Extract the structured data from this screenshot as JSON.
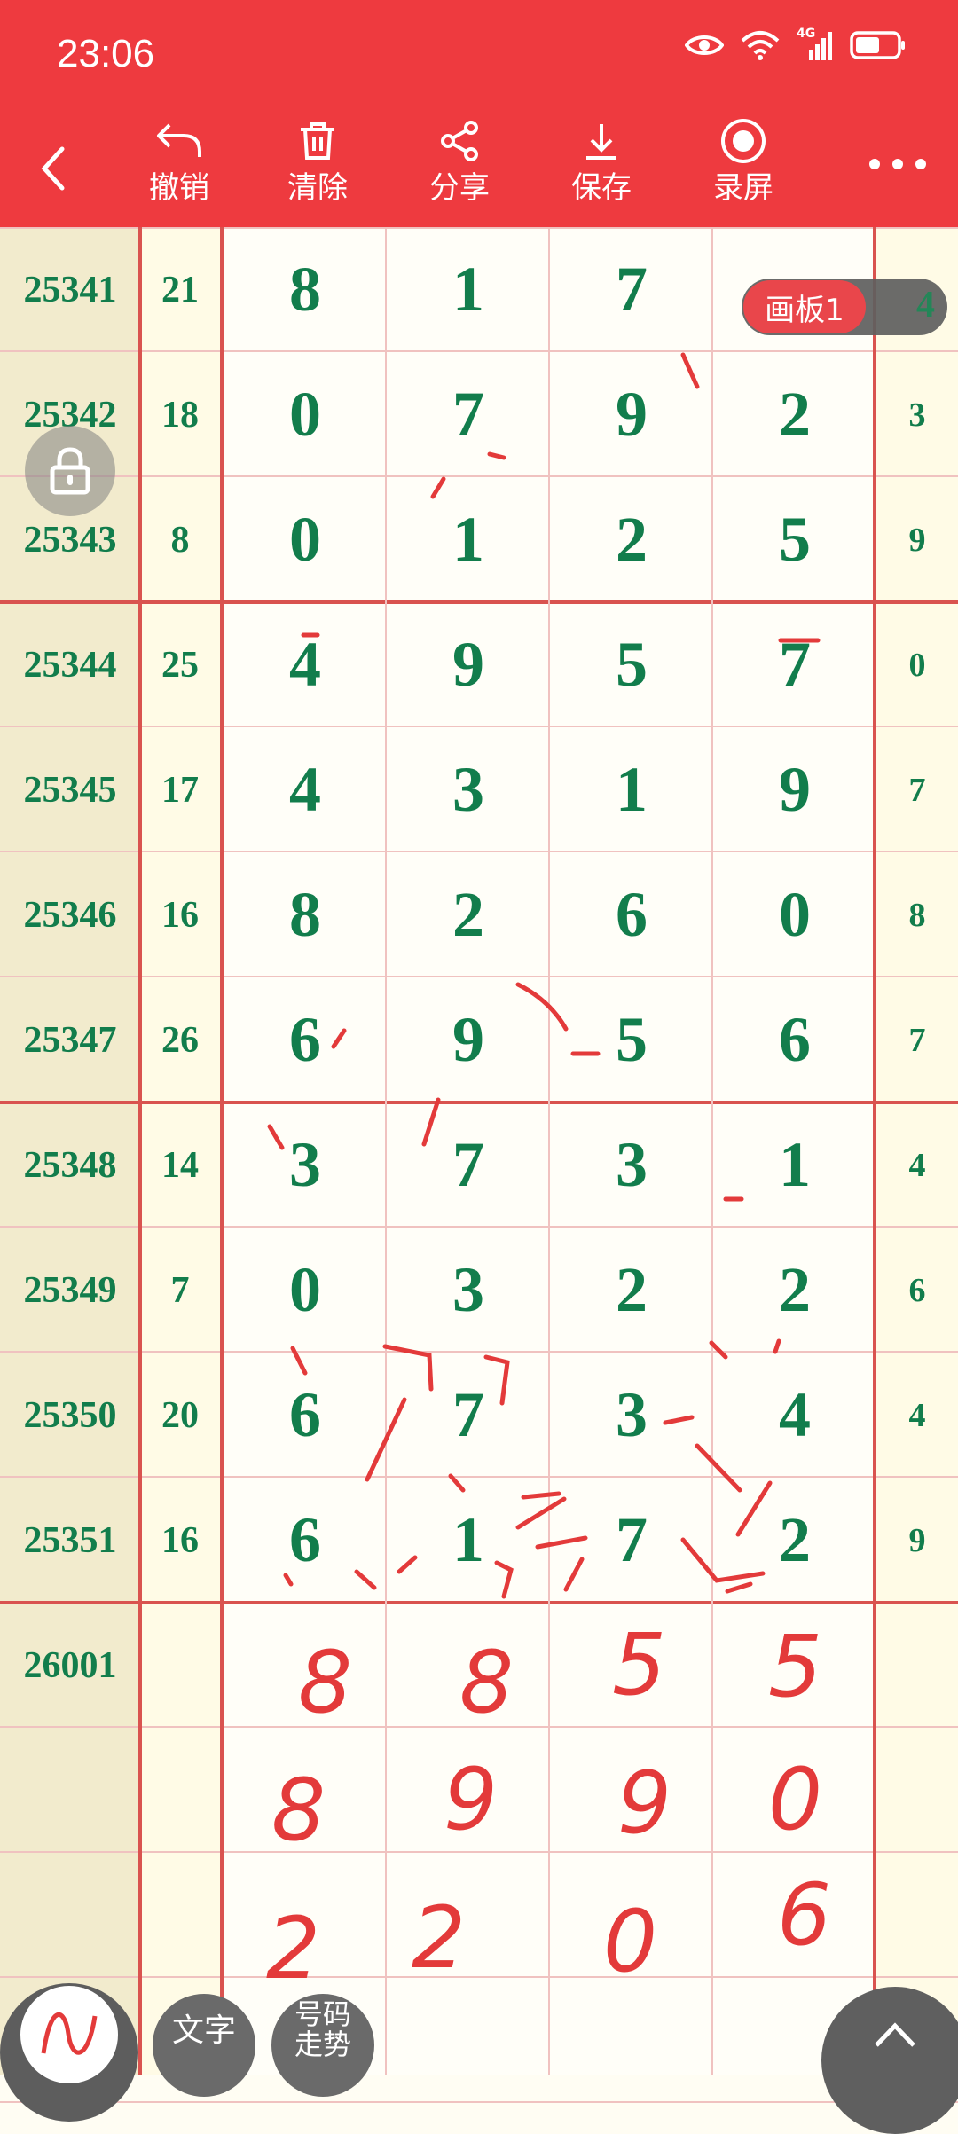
{
  "status": {
    "time": "23:06",
    "network": "4G"
  },
  "toolbar": {
    "back_icon": "back-chevron-icon",
    "items": [
      {
        "label": "撤销",
        "icon": "undo-icon"
      },
      {
        "label": "清除",
        "icon": "trash-icon"
      },
      {
        "label": "分享",
        "icon": "share-icon"
      },
      {
        "label": "保存",
        "icon": "download-icon"
      },
      {
        "label": "录屏",
        "icon": "record-icon"
      }
    ],
    "more_icon": "more-dots-icon"
  },
  "colors": {
    "header": "#ee3a3f",
    "digit": "#127d4c",
    "ink": "#e33a3a"
  },
  "board": {
    "label": "画板1",
    "last_peek": "4"
  },
  "rows": [
    {
      "period": "25341",
      "sum": "21",
      "d": [
        "8",
        "1",
        "7",
        ""
      ],
      "last": ""
    },
    {
      "period": "25342",
      "sum": "18",
      "d": [
        "0",
        "7",
        "9",
        "2"
      ],
      "last": "3"
    },
    {
      "period": "25343",
      "sum": "8",
      "d": [
        "0",
        "1",
        "2",
        "5"
      ],
      "last": "9"
    },
    {
      "period": "25344",
      "sum": "25",
      "d": [
        "4",
        "9",
        "5",
        "7"
      ],
      "last": "0"
    },
    {
      "period": "25345",
      "sum": "17",
      "d": [
        "4",
        "3",
        "1",
        "9"
      ],
      "last": "7"
    },
    {
      "period": "25346",
      "sum": "16",
      "d": [
        "8",
        "2",
        "6",
        "0"
      ],
      "last": "8"
    },
    {
      "period": "25347",
      "sum": "26",
      "d": [
        "6",
        "9",
        "5",
        "6"
      ],
      "last": "7"
    },
    {
      "period": "25348",
      "sum": "14",
      "d": [
        "3",
        "7",
        "3",
        "1"
      ],
      "last": "4"
    },
    {
      "period": "25349",
      "sum": "7",
      "d": [
        "0",
        "3",
        "2",
        "2"
      ],
      "last": "6"
    },
    {
      "period": "25350",
      "sum": "20",
      "d": [
        "6",
        "7",
        "3",
        "4"
      ],
      "last": "4"
    },
    {
      "period": "25351",
      "sum": "16",
      "d": [
        "6",
        "1",
        "7",
        "2"
      ],
      "last": "9"
    },
    {
      "period": "26001",
      "sum": "",
      "d": [
        "",
        "",
        "",
        ""
      ],
      "last": ""
    },
    {
      "period": "",
      "sum": "",
      "d": [
        "",
        "",
        "",
        ""
      ],
      "last": ""
    },
    {
      "period": "",
      "sum": "",
      "d": [
        "",
        "",
        "",
        ""
      ],
      "last": ""
    },
    {
      "period": "",
      "sum": "",
      "d": [
        "",
        "",
        "",
        ""
      ],
      "last": ""
    }
  ],
  "handwritten": [
    "8",
    "8",
    "5",
    "5",
    "8",
    "9",
    "9",
    "0",
    "2",
    "2",
    "0",
    "6"
  ],
  "fabs": {
    "text_label": "文字",
    "trend_label": "号码走势"
  }
}
